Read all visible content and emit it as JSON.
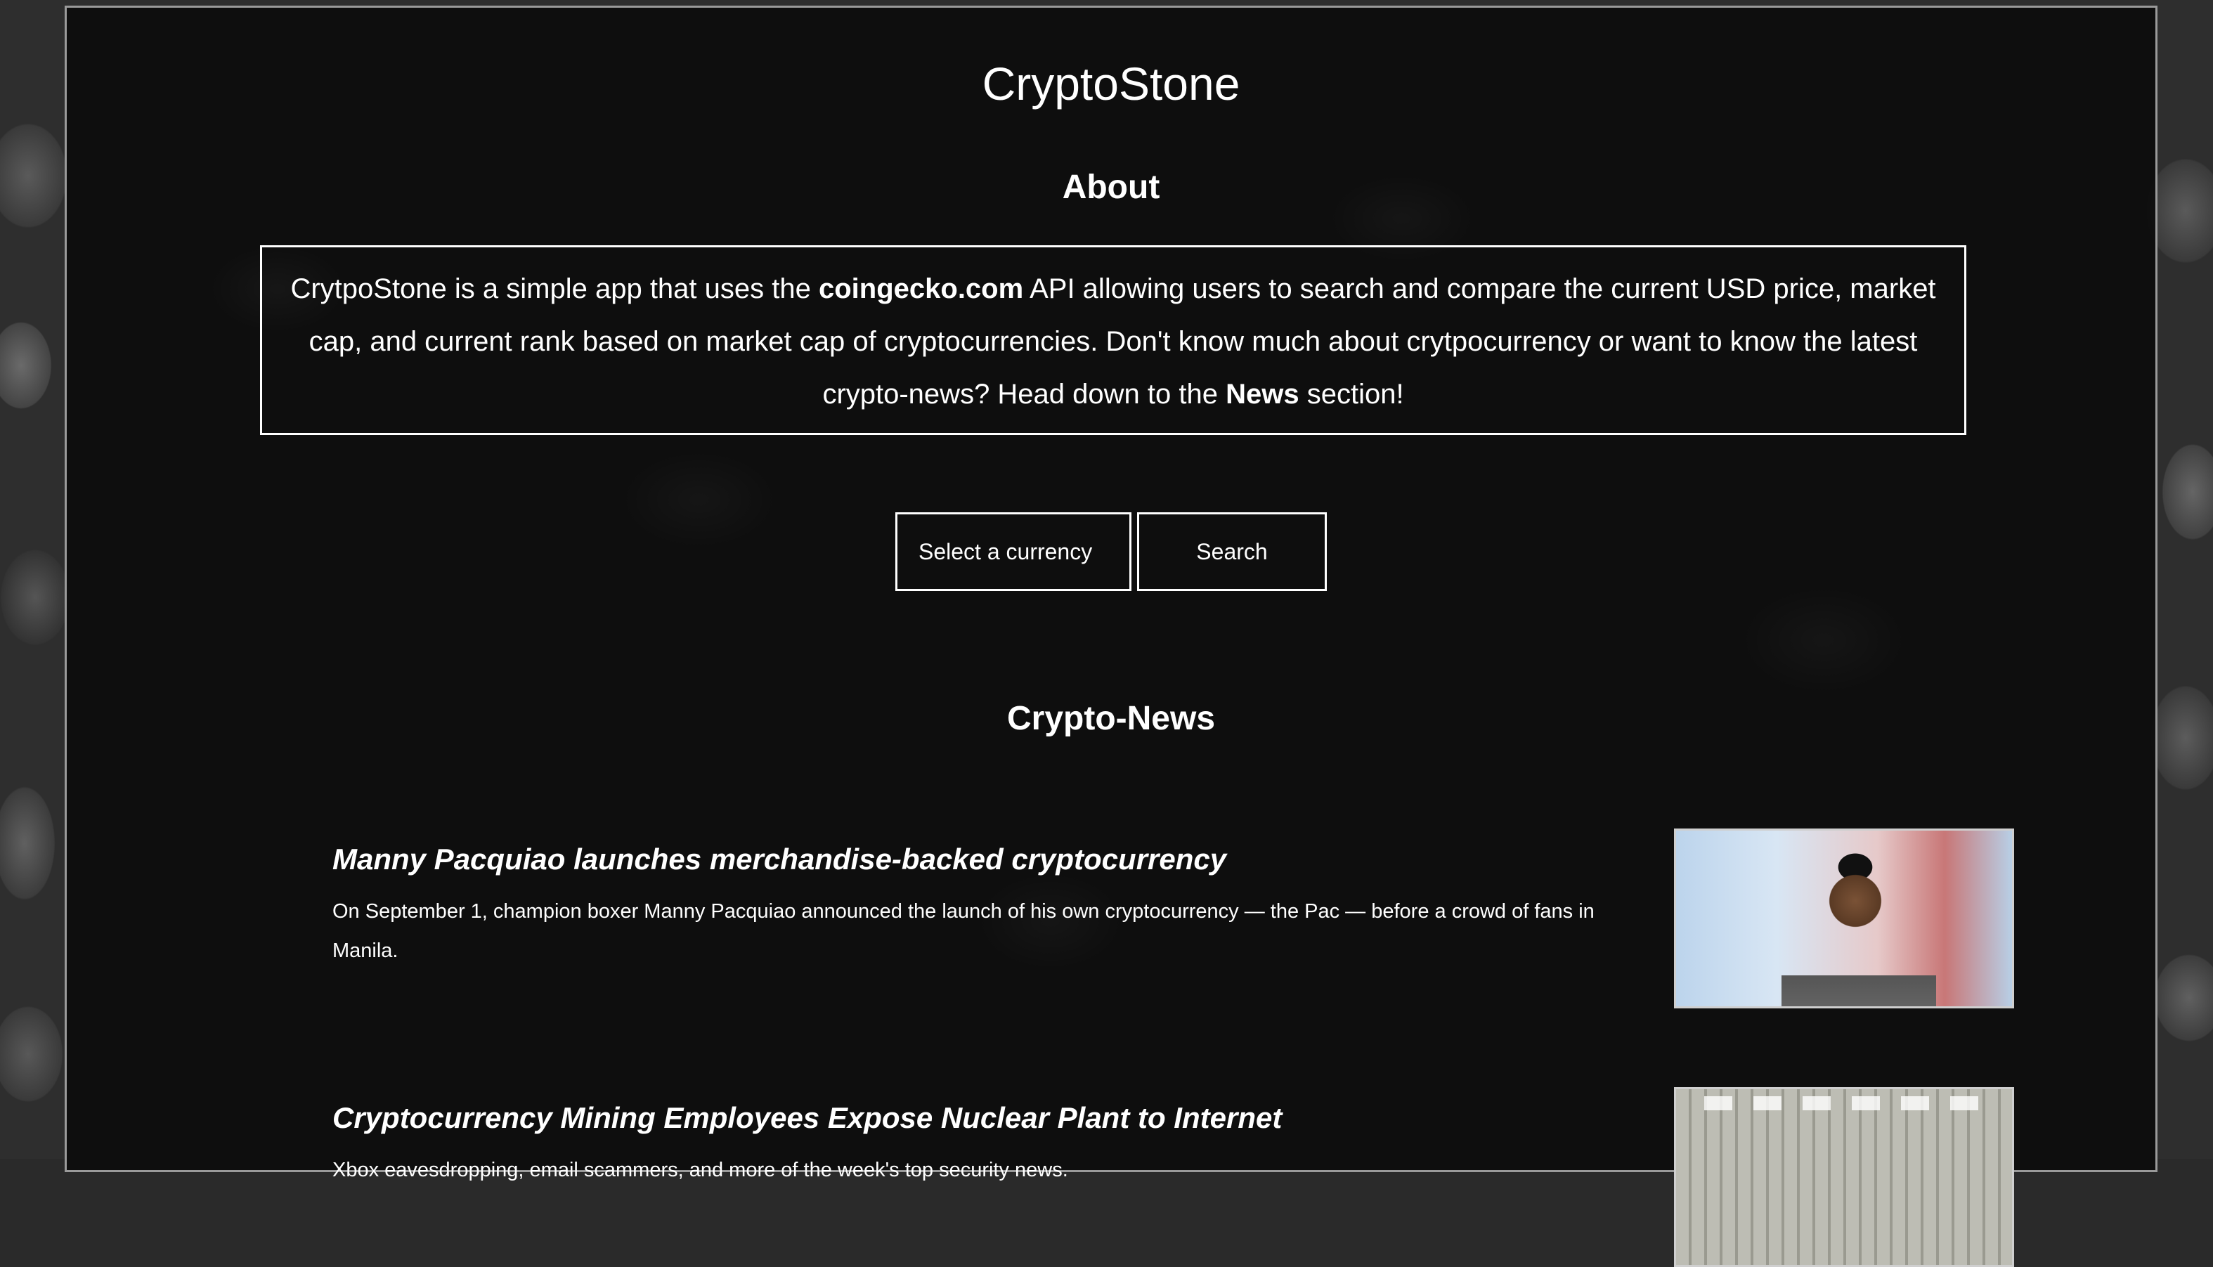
{
  "header": {
    "title": "CryptoStone"
  },
  "about": {
    "heading": "About",
    "text_1": "CrytpoStone is a simple app that uses the ",
    "link_api": "coingecko.com",
    "text_2": " API allowing users to search and compare the current USD price, market cap, and current rank based on market cap of cryptocurrencies. Don't know much about crytpocurrency or want to know the latest crypto-news? Head down to the ",
    "link_news": "News",
    "text_3": " section!"
  },
  "search": {
    "select_label": "Select a currency",
    "button_label": "Search"
  },
  "news": {
    "heading": "Crypto-News",
    "items": [
      {
        "title": "Manny Pacquiao launches merchandise-backed cryptocurrency",
        "description": "On September 1, champion boxer Manny Pacquiao announced the launch of his own cryptocurrency — the Pac — before a crowd of fans in Manila."
      },
      {
        "title": "Cryptocurrency Mining Employees Expose Nuclear Plant to Internet",
        "description": "Xbox eavesdropping, email scammers, and more of the week's top security news."
      }
    ]
  }
}
